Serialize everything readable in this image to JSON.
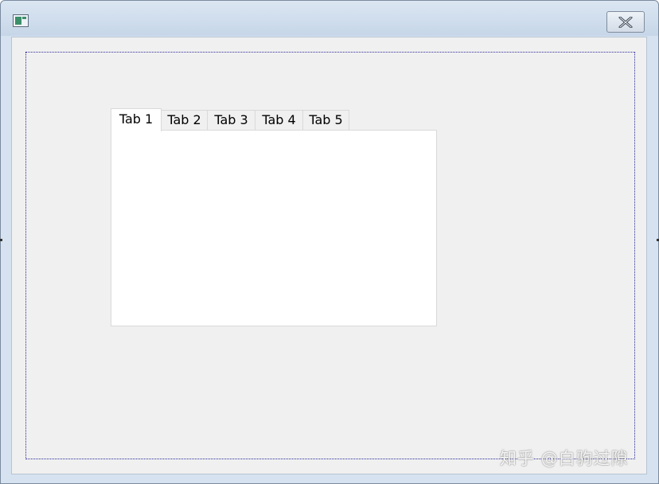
{
  "window": {
    "icon": "app-window-icon",
    "close_icon": "close-x-icon"
  },
  "tabs": [
    {
      "label": "Tab 1",
      "selected": true
    },
    {
      "label": "Tab 2",
      "selected": false
    },
    {
      "label": "Tab 3",
      "selected": false
    },
    {
      "label": "Tab 4",
      "selected": false
    },
    {
      "label": "Tab 5",
      "selected": false
    }
  ],
  "watermark": "知乎 @白驹过隙",
  "colors": {
    "title_bar": "#c6d6e8",
    "client_background": "#f0f0f0",
    "focus_rect": "#2b2b9a",
    "tab_panel": "#ffffff"
  }
}
